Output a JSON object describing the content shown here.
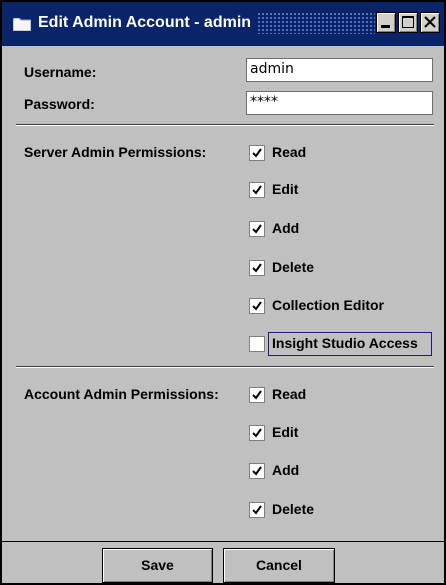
{
  "window": {
    "title": "Edit Admin Account - admin"
  },
  "form": {
    "username_label": "Username:",
    "username_value": "admin",
    "password_label": "Password:",
    "password_value": "****"
  },
  "server_permissions": {
    "label": "Server Admin Permissions:",
    "items": [
      {
        "label": "Read",
        "checked": true
      },
      {
        "label": "Edit",
        "checked": true
      },
      {
        "label": "Add",
        "checked": true
      },
      {
        "label": "Delete",
        "checked": true
      },
      {
        "label": "Collection Editor",
        "checked": true
      },
      {
        "label": "Insight Studio Access",
        "checked": false
      }
    ]
  },
  "account_permissions": {
    "label": "Account Admin Permissions:",
    "items": [
      {
        "label": "Read",
        "checked": true
      },
      {
        "label": "Edit",
        "checked": true
      },
      {
        "label": "Add",
        "checked": true
      },
      {
        "label": "Delete",
        "checked": true
      }
    ]
  },
  "buttons": {
    "save": "Save",
    "cancel": "Cancel"
  },
  "icons": {
    "title": "folder-icon",
    "minimize": "minimize-icon",
    "maximize": "maximize-icon",
    "close": "close-icon"
  },
  "colors": {
    "titlebar": "#0a246a",
    "window_bg": "#c0c0c0"
  }
}
